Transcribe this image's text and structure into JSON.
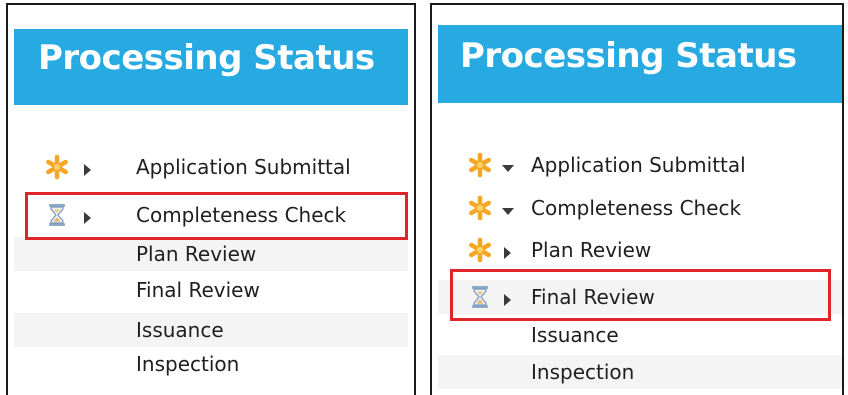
{
  "panels": [
    {
      "title": "Processing Status",
      "steps": [
        {
          "label": "Application Submittal",
          "status_icon": "asterisk-icon",
          "toggle": "chevron-right-icon",
          "highlighted": false
        },
        {
          "label": "Completeness Check",
          "status_icon": "hourglass-icon",
          "toggle": "chevron-right-icon",
          "highlighted": true
        },
        {
          "label": "Plan Review",
          "status_icon": "",
          "toggle": "",
          "highlighted": false
        },
        {
          "label": "Final Review",
          "status_icon": "",
          "toggle": "",
          "highlighted": false
        },
        {
          "label": "Issuance",
          "status_icon": "",
          "toggle": "",
          "highlighted": false
        },
        {
          "label": "Inspection",
          "status_icon": "",
          "toggle": "",
          "highlighted": false
        }
      ]
    },
    {
      "title": "Processing Status",
      "steps": [
        {
          "label": "Application Submittal",
          "status_icon": "asterisk-icon",
          "toggle": "chevron-down-icon",
          "highlighted": false
        },
        {
          "label": "Completeness Check",
          "status_icon": "asterisk-icon",
          "toggle": "chevron-down-icon",
          "highlighted": false
        },
        {
          "label": "Plan Review",
          "status_icon": "asterisk-icon",
          "toggle": "chevron-right-icon",
          "highlighted": false
        },
        {
          "label": "Final Review",
          "status_icon": "hourglass-icon",
          "toggle": "chevron-right-icon",
          "highlighted": true
        },
        {
          "label": "Issuance",
          "status_icon": "",
          "toggle": "",
          "highlighted": false
        },
        {
          "label": "Inspection",
          "status_icon": "",
          "toggle": "",
          "highlighted": false
        }
      ]
    }
  ],
  "colors": {
    "header": "#27a9e1",
    "highlight": "#e0242b",
    "asterisk": "#f5a623",
    "row_alt": "#f4f4f4"
  }
}
